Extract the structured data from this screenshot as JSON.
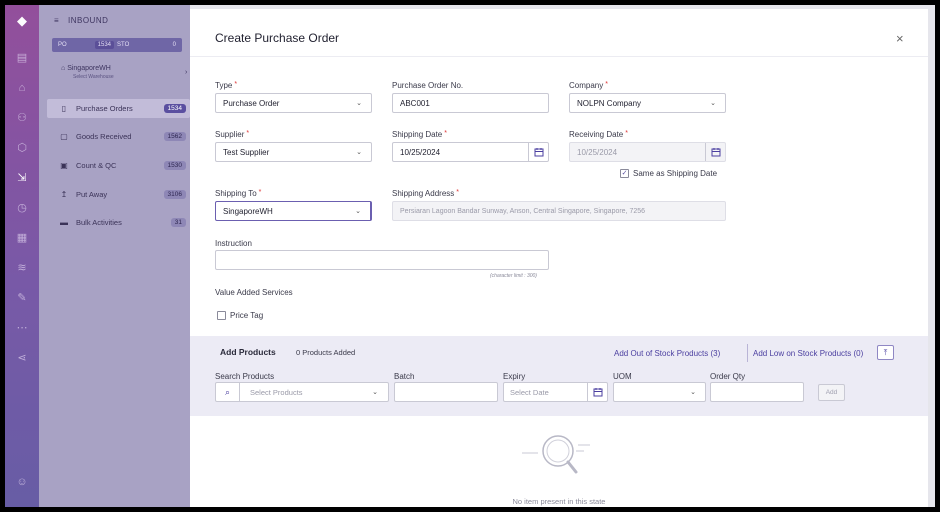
{
  "rail_icons": [
    "logo-icon",
    "dashboard-icon",
    "home-icon",
    "users-icon",
    "box-icon",
    "inbound-icon",
    "clock-icon",
    "grid-icon",
    "layers-icon",
    "edit-icon",
    "more-icon",
    "share-icon",
    "user-icon"
  ],
  "sidebar": {
    "header": "INBOUND",
    "tabs": {
      "po": "PO",
      "po_count": "1534",
      "sto": "STO",
      "sto_count": "0"
    },
    "warehouse": {
      "name": "SingaporeWH",
      "sub": "Select Warehouse"
    },
    "items": [
      {
        "label": "Purchase Orders",
        "count": "1534",
        "icon": "document-icon"
      },
      {
        "label": "Goods Received",
        "count": "1562",
        "icon": "clipboard-icon"
      },
      {
        "label": "Count & QC",
        "count": "1530",
        "icon": "calendar-icon"
      },
      {
        "label": "Put Away",
        "count": "3106",
        "icon": "putaway-icon"
      },
      {
        "label": "Bulk Activities",
        "count": "31",
        "icon": "bulk-icon"
      }
    ]
  },
  "modal": {
    "title": "Create Purchase Order",
    "close": "×",
    "type": {
      "label": "Type",
      "value": "Purchase Order"
    },
    "po_no": {
      "label": "Purchase Order No.",
      "value": "ABC001"
    },
    "company": {
      "label": "Company",
      "value": "NOLPN Company"
    },
    "supplier": {
      "label": "Supplier",
      "value": "Test Supplier"
    },
    "shipping_date": {
      "label": "Shipping Date",
      "value": "10/25/2024"
    },
    "receiving_date": {
      "label": "Receiving Date",
      "value": "10/25/2024"
    },
    "same_as_shipping": {
      "label": "Same as Shipping Date",
      "checked": true
    },
    "shipping_to": {
      "label": "Shipping To",
      "value": "SingaporeWH"
    },
    "shipping_address": {
      "label": "Shipping Address",
      "value": "Persiaran Lagoon Bandar Sunway, Anson, Central Singapore, Singapore, 7256"
    },
    "instruction": {
      "label": "Instruction",
      "value": "",
      "hint": "(character limit : 300)"
    },
    "vas": {
      "label": "Value Added Services",
      "price_tag": "Price Tag"
    },
    "add_products": {
      "title": "Add Products",
      "count": "0 Products Added",
      "out_of_stock": "Add Out of Stock Products (3)",
      "low_on_stock": "Add Low on Stock Products (0)",
      "search_label": "Search Products",
      "search_placeholder": "Select Products",
      "batch_label": "Batch",
      "expiry_label": "Expiry",
      "expiry_placeholder": "Select Date",
      "uom_label": "UOM",
      "qty_label": "Order Qty",
      "add_button": "Add"
    },
    "empty_text": "No item present in this state"
  },
  "colors": {
    "accent": "#4b3fa0",
    "sidebar_bg": "#a8a2c4",
    "rail_top": "#8a3f93",
    "required": "#d33333"
  }
}
